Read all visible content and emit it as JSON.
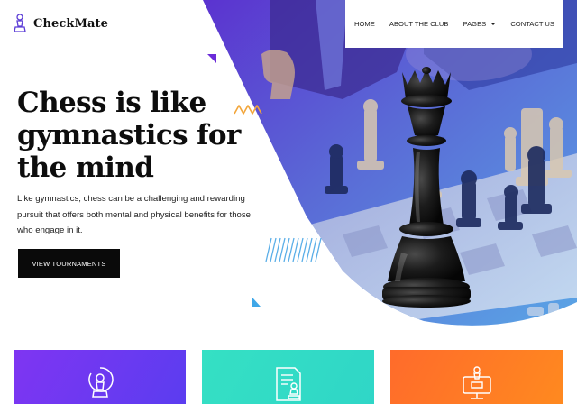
{
  "brand": {
    "name": "CheckMate",
    "logo_icon": "chess-pawn-icon"
  },
  "nav": {
    "items": [
      {
        "label": "HOME"
      },
      {
        "label": "ABOUT THE CLUB"
      },
      {
        "label": "PAGES",
        "icon": "caret-down-icon"
      },
      {
        "label": "CONTACT US"
      }
    ]
  },
  "hero": {
    "title_lines": [
      "Chess is like",
      "gymnastics for",
      "the mind"
    ],
    "description": "Like gymnastics, chess can be a challenging and rewarding pursuit that offers both mental and physical benefits for those who engage in it.",
    "cta_label": "VIEW TOURNAMENTS",
    "image_subject": "black chess queen on a chessboard",
    "decor_icons": [
      "zigzag-icon",
      "diagonal-lines-icon",
      "triangle-icon"
    ]
  },
  "cards": [
    {
      "icon": "pawn-target-icon",
      "color": "#7f35f2"
    },
    {
      "icon": "document-pawn-icon",
      "color": "#35e0c4"
    },
    {
      "icon": "monitor-pawn-icon",
      "color": "#ff7a25"
    }
  ],
  "colors": {
    "primary_purple": "#6b3cf0",
    "accent_blue": "#3fa7e8",
    "accent_orange": "#f2a53a",
    "button_black": "#0a0a0a"
  }
}
